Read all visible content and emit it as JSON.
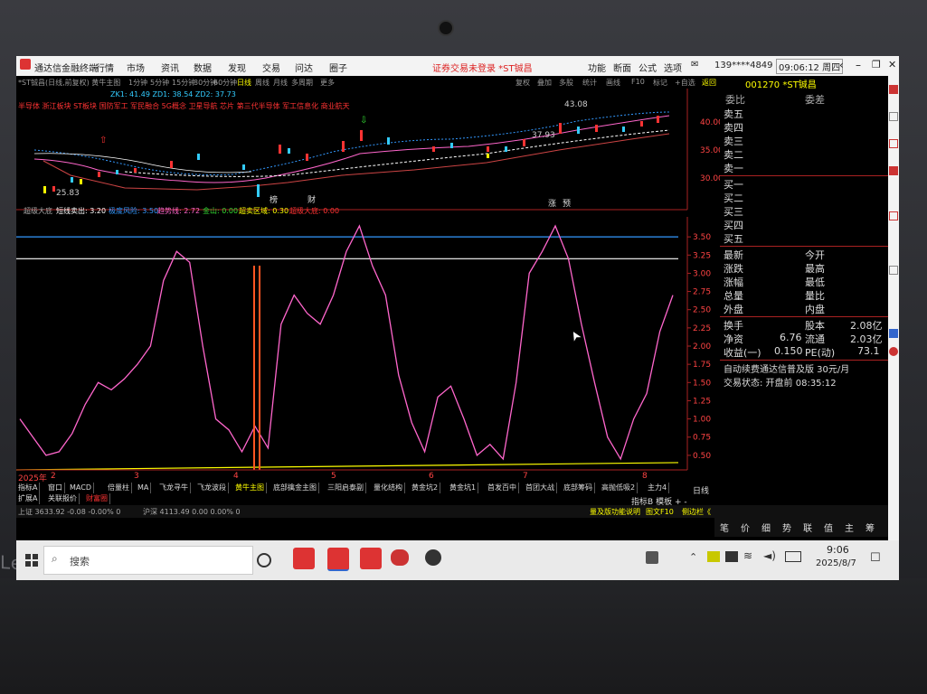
{
  "window": {
    "app_title": "通达信金融终端",
    "menu": [
      "行情",
      "市场",
      "资讯",
      "数据",
      "发现",
      "交易",
      "问达",
      "圈子"
    ],
    "center_title": "证券交易未登录 *ST铖昌",
    "right_menu": [
      "功能",
      "断面",
      "公式",
      "选项"
    ],
    "account": "139****4849",
    "clock": "09:06:12 周四"
  },
  "toolbar": {
    "left": "*ST铖昌(日线,前复权) 黄牛主图",
    "periods": [
      "1分钟",
      "5分钟",
      "15分钟",
      "30分钟",
      "60分钟",
      "日线",
      "周线",
      "月线",
      "多周期",
      "更多"
    ],
    "active_period": "日线",
    "right_tools": [
      "复权",
      "叠加",
      "多股",
      "统计",
      "画线",
      "F10",
      "标记",
      "+自选",
      "返回"
    ],
    "stock_header": "001270 *ST铖昌",
    "main_indicators": "ZK1: 41.49  ZD1: 38.54  ZD2: 37.73",
    "concept_line": "半导体 浙江板块 ST板块 国防军工 军民融合 5G概念 卫星导航 芯片 第三代半导体 军工信息化 商业航天"
  },
  "price_chart": {
    "labels": {
      "high": "43.08",
      "low": "25.83",
      "mid": "37.93"
    },
    "axis": [
      "40.00",
      "35.00",
      "30.00"
    ],
    "markers": [
      "榜",
      "财",
      "涨",
      "预"
    ]
  },
  "indicator": {
    "name": "超级大底",
    "params": [
      {
        "label": "短线卖出: 3.20",
        "color": "#ffffff"
      },
      {
        "label": "极度风险: 3.50",
        "color": "#3399ff"
      },
      {
        "label": "趋势线: 2.72",
        "color": "#ff66cc"
      },
      {
        "label": "金山: 0.00",
        "color": "#33dd33"
      },
      {
        "label": "超卖区域: 0.30",
        "color": "#ffff00"
      },
      {
        "label": "超级大底: 0.00",
        "color": "#ff3333"
      }
    ],
    "axis": [
      "3.50",
      "3.25",
      "3.00",
      "2.75",
      "2.50",
      "2.25",
      "2.00",
      "1.75",
      "1.50",
      "1.25",
      "1.00",
      "0.75",
      "0.50"
    ]
  },
  "chart_data": {
    "type": "line",
    "title": "超级大底",
    "ylim": [
      0.3,
      3.7
    ],
    "series": [
      {
        "name": "趋势线",
        "color": "#ff66cc",
        "values": [
          1.0,
          0.75,
          0.5,
          0.55,
          0.8,
          1.2,
          1.5,
          1.4,
          1.55,
          1.75,
          2.0,
          2.9,
          3.3,
          3.15,
          2.0,
          1.0,
          0.85,
          0.55,
          0.9,
          0.6,
          2.3,
          2.7,
          2.45,
          2.3,
          2.7,
          3.3,
          3.65,
          3.1,
          2.7,
          1.6,
          0.95,
          0.55,
          1.3,
          1.45,
          1.0,
          0.5,
          0.65,
          0.45,
          1.5,
          3.0,
          3.3,
          3.65,
          3.2,
          2.3,
          1.5,
          0.75,
          0.45,
          1.0,
          1.35,
          2.2,
          2.7
        ]
      },
      {
        "name": "极度风险",
        "color": "#3399ff",
        "values": [
          3.5
        ]
      },
      {
        "name": "短线卖出",
        "color": "#ffffff",
        "values": [
          3.2
        ]
      },
      {
        "name": "超卖区域",
        "color": "#ffff00",
        "values": [
          0.3
        ]
      }
    ],
    "dates": [
      "2025年",
      "2",
      "3",
      "4",
      "5",
      "6",
      "7",
      "8"
    ]
  },
  "right_panel": {
    "order_header": [
      "委比",
      "委差"
    ],
    "sells": [
      "卖五",
      "卖四",
      "卖三",
      "卖二",
      "卖一"
    ],
    "buys": [
      "买一",
      "买二",
      "买三",
      "买四",
      "买五"
    ],
    "quote": [
      [
        "最新",
        "今开"
      ],
      [
        "涨跌",
        "最高"
      ],
      [
        "涨幅",
        "最低"
      ],
      [
        "总量",
        "量比"
      ],
      [
        "外盘",
        "内盘"
      ]
    ],
    "stats": [
      {
        "k": "换手",
        "k2": "股本",
        "v": "2.08亿"
      },
      {
        "k": "净资",
        "v1": "6.76",
        "k2": "流通",
        "v": "2.03亿"
      },
      {
        "k": "收益(一)",
        "v1": "0.150",
        "k2": "PE(动)",
        "v": "73.1"
      }
    ],
    "notice": "自动续费通达信普及版 30元/月",
    "trade_status": "交易状态: 开盘前 08:35:12"
  },
  "bottom_tabs_1": [
    "指标A",
    "窗口",
    "MACD",
    "倍量柱",
    "MA",
    "飞龙寻牛",
    "飞龙波段",
    "黄牛主图",
    "底部擒金主图",
    "三阳启泰副",
    "量化结构",
    "黄金坑2",
    "黄金坑1",
    "首发百中",
    "首团大战",
    "底部筹码",
    "高抛低吸2",
    "主力4"
  ],
  "bottom_tabs_2": [
    "扩展A",
    "关联报价",
    "财富圈"
  ],
  "bottom_right": [
    "指标B",
    "模板",
    "+",
    "-"
  ],
  "right_strip_label": "日线",
  "status_bar": {
    "sh": "上证 3633.92 -0.08 -0.00% 0",
    "sz": "沪深 4113.49 0.00 0.00% 0",
    "hint": "量及版功能说明",
    "buttons": [
      "图文F10",
      "侧边栏《"
    ],
    "quick": [
      "笔",
      "价",
      "细",
      "势",
      "联",
      "值",
      "主",
      "筹"
    ]
  },
  "taskbar": {
    "search": "搜索",
    "time": "9:06",
    "date": "2025/8/7"
  },
  "brand": "Lenovo"
}
